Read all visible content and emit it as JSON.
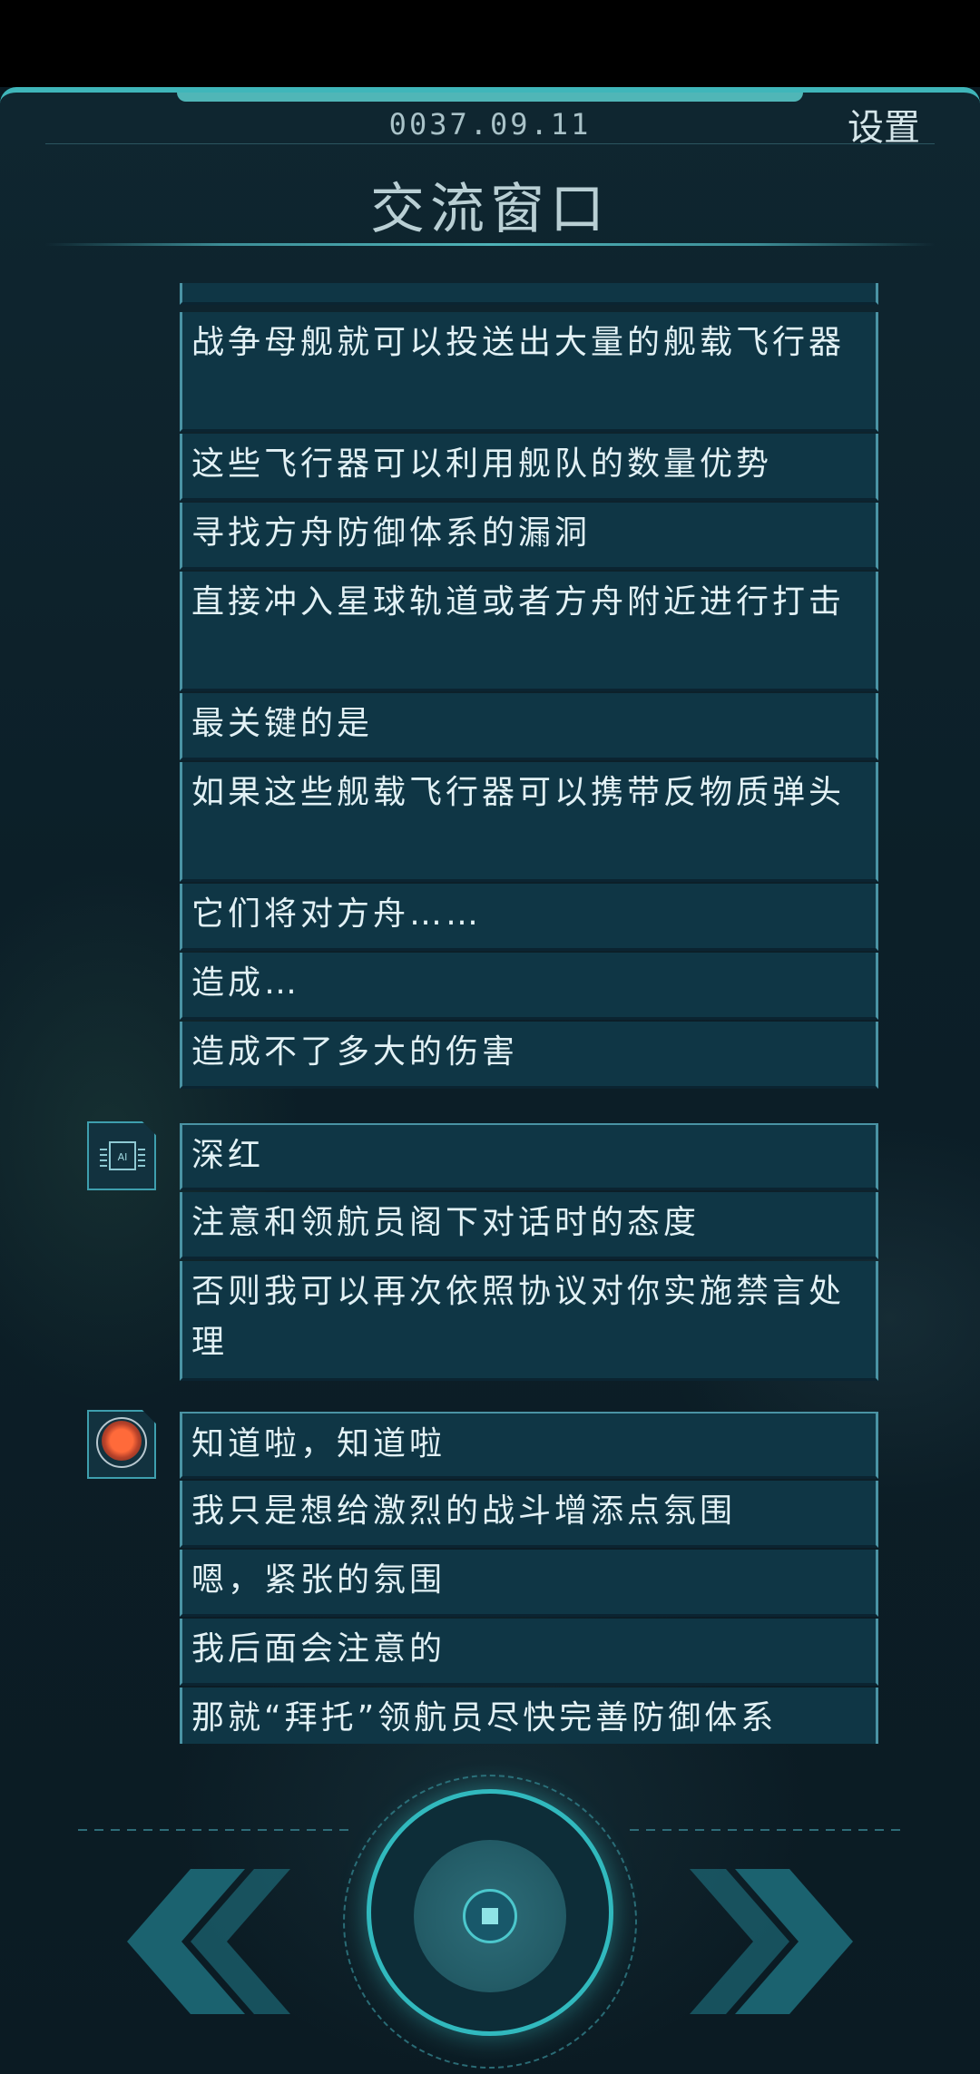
{
  "header": {
    "date": "0037.09.11",
    "settings_label": "设置",
    "title": "交流窗口"
  },
  "messages": [
    {
      "text": "战争母舰就可以投送出大量的舰载飞行器"
    },
    {
      "text": "这些飞行器可以利用舰队的数量优势"
    },
    {
      "text": "寻找方舟防御体系的漏洞"
    },
    {
      "text": "直接冲入星球轨道或者方舟附近进行打击"
    },
    {
      "text": "最关键的是"
    },
    {
      "text": "如果这些舰载飞行器可以携带反物质弹头"
    },
    {
      "text": "它们将对方舟……"
    },
    {
      "text": "造成…"
    },
    {
      "text": "造成不了多大的伤害"
    },
    {
      "text": "深红"
    },
    {
      "text": "注意和领航员阁下对话时的态度"
    },
    {
      "text": "否则我可以再次依照协议对你实施禁言处理"
    },
    {
      "text": "知道啦，知道啦"
    },
    {
      "text": "我只是想给激烈的战斗增添点氛围"
    },
    {
      "text": "嗯，紧张的氛围"
    },
    {
      "text": "我后面会注意的"
    },
    {
      "text": "那就“拜托”领航员尽快完善防御体系"
    }
  ],
  "avatars": {
    "ai_label": "AI",
    "ai_icon": "ai-chip-icon",
    "player_icon": "red-orb-icon"
  },
  "controls": {
    "prev_icon": "double-chevron-left",
    "play_icon": "stop-square",
    "next_icon": "double-chevron-right"
  },
  "colors": {
    "accent": "#31b9be",
    "bubble_bg": "#0f3645",
    "bubble_border": "#4a93a4"
  }
}
